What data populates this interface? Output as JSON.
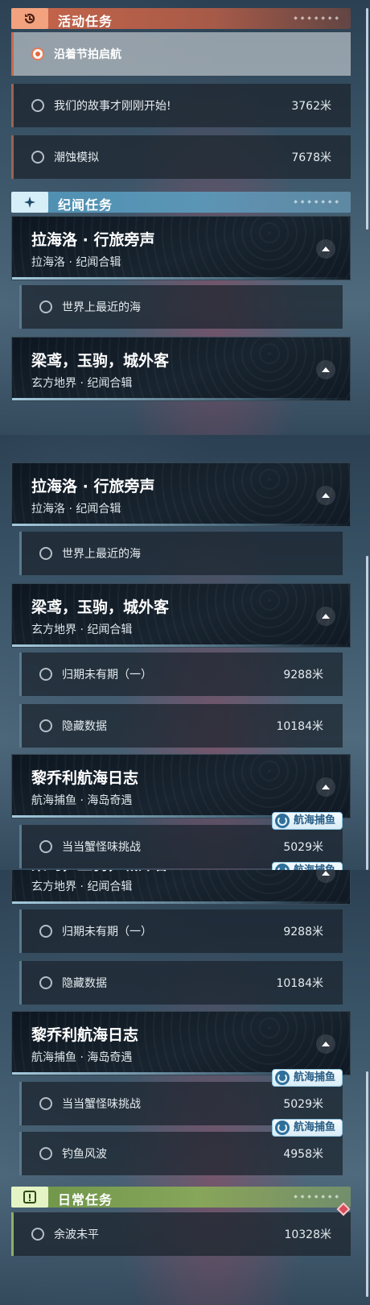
{
  "sections": {
    "activity": {
      "title": "活动任务",
      "deco": "◆ ◆ ◆ ◆ ◆ ◆ ◆"
    },
    "story": {
      "title": "纪闻任务",
      "deco": "◆ ◆ ◆ ◆ ◆ ◆ ◆"
    },
    "daily": {
      "title": "日常任务",
      "deco": "◆ ◆ ◆ ◆ ◆ ◆ ◆"
    }
  },
  "activity_quests": [
    {
      "name": "沿着节拍启航",
      "distance": "",
      "active": true
    },
    {
      "name": "我们的故事才刚刚开始!",
      "distance": "3762米"
    },
    {
      "name": "潮蚀模拟",
      "distance": "7678米"
    }
  ],
  "questlines": [
    {
      "title": "拉海洛 · 行旅旁声",
      "subtitle": "拉海洛 · 纪闻合辑",
      "quests": [
        {
          "name": "世界上最近的海",
          "distance": ""
        }
      ]
    },
    {
      "title": "梁鸢，玉驹，城外客",
      "subtitle": "玄方地界 · 纪闻合辑",
      "quests": [
        {
          "name": "归期未有期（一）",
          "distance": "9288米"
        },
        {
          "name": "隐藏数据",
          "distance": "10184米"
        }
      ]
    },
    {
      "title": "黎乔利航海日志",
      "subtitle": "航海捕鱼 · 海岛奇遇",
      "quests": [
        {
          "name": "当当蟹怪味挑战",
          "distance": "5029米"
        },
        {
          "name": "钓鱼风波",
          "distance": "4958米"
        }
      ]
    }
  ],
  "tag_label": "航海捕鱼",
  "daily_quests": [
    {
      "name": "余波未平",
      "distance": "10328米"
    }
  ],
  "icons": {
    "activity": "refresh-task-icon",
    "story": "sparkle-icon",
    "daily": "exclamation-icon",
    "collapse": "chevron-up-icon",
    "tag": "fishing-hook-icon",
    "alert": "diamond-alert-icon"
  },
  "colors": {
    "activity": "#c8654a",
    "story": "#4d90b2",
    "daily": "#6d9448",
    "active_radio": "#e06a44",
    "alert": "#d94b58"
  }
}
